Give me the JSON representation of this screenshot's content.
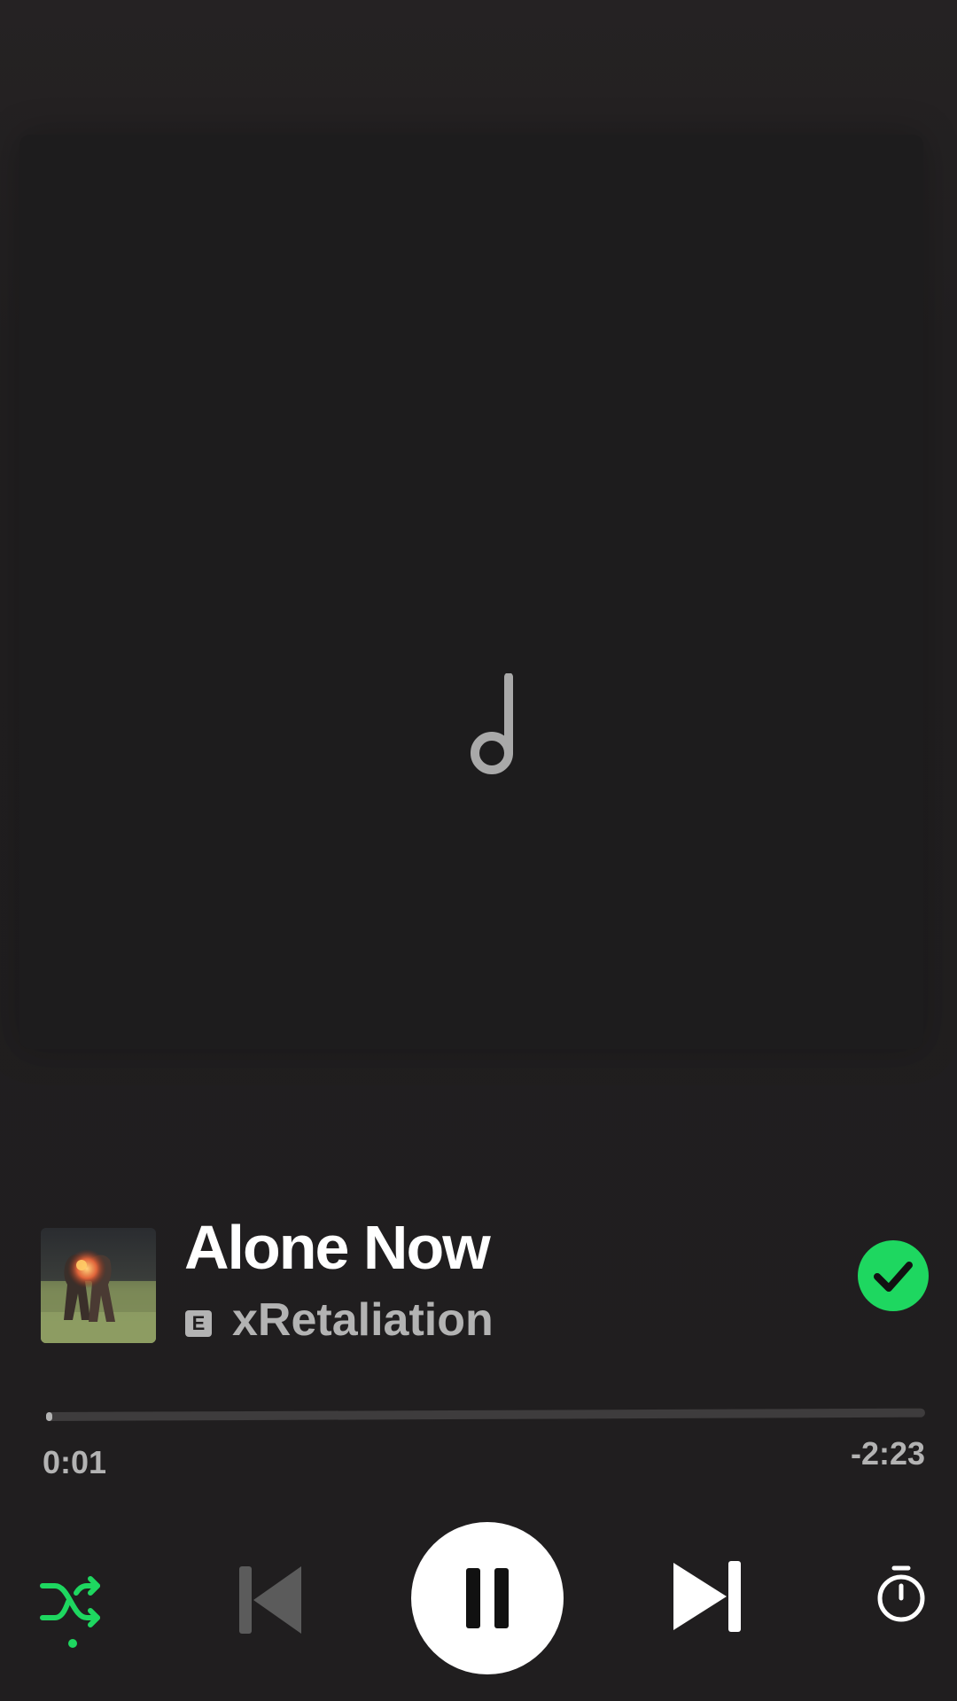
{
  "track": {
    "title": "Alone Now",
    "artist": "xRetaliation",
    "explicit_label": "E",
    "saved": true
  },
  "playback": {
    "elapsed": "0:01",
    "remaining": "-2:23",
    "progress_fraction": 0.007,
    "state": "playing",
    "shuffle_on": true
  },
  "icons": {
    "artwork_placeholder": "music-note-icon",
    "saved": "check-circle-icon",
    "shuffle": "shuffle-icon",
    "previous": "skip-previous-icon",
    "play_pause": "pause-icon",
    "next": "skip-next-icon",
    "sleep_timer": "timer-icon"
  },
  "colors": {
    "accent": "#1ed760",
    "background": "#201e1f",
    "text_primary": "#ffffff",
    "text_secondary": "#b3b3b3"
  }
}
